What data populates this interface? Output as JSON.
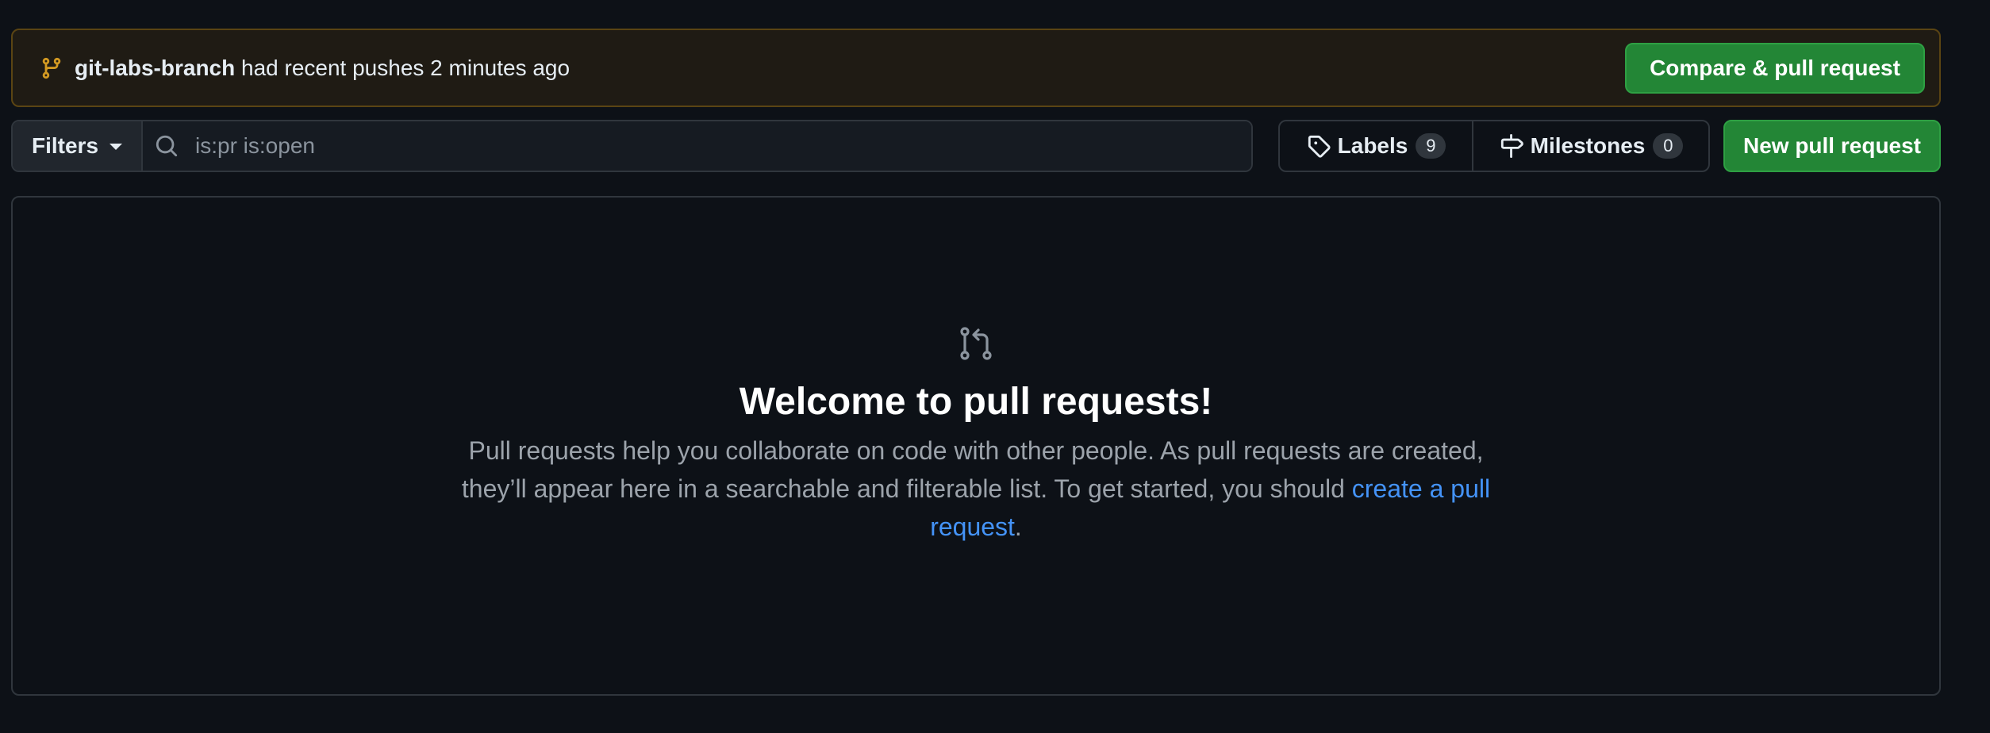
{
  "banner": {
    "branch_name": "git-labs-branch",
    "message": "had recent pushes 2 minutes ago",
    "compare_button": "Compare & pull request"
  },
  "toolbar": {
    "filters_label": "Filters",
    "search": {
      "value": "",
      "placeholder": "is:pr is:open"
    },
    "labels_label": "Labels",
    "labels_count": "9",
    "milestones_label": "Milestones",
    "milestones_count": "0",
    "new_pr_button": "New pull request"
  },
  "empty_state": {
    "title": "Welcome to pull requests!",
    "description": "Pull requests help you collaborate on code with other people. As pull requests are created, they’ll appear here in a searchable and filterable list. To get started, you should ",
    "link_text": "create a pull request",
    "trailing": "."
  },
  "colors": {
    "background": "#0d1117",
    "green": "#238636",
    "link": "#4493f8",
    "banner_icon": "#d29922"
  },
  "icons": [
    "git-branch-icon",
    "caret-down-icon",
    "search-icon",
    "tag-icon",
    "milestone-icon",
    "git-pull-request-icon"
  ]
}
